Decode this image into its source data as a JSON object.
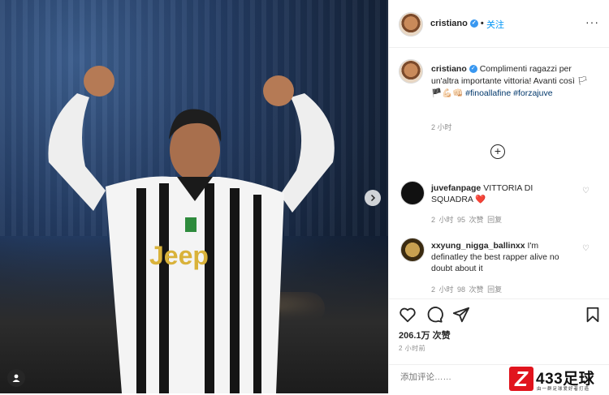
{
  "post": {
    "username": "cristiano",
    "verified_mark": "✓",
    "dot": "•",
    "follow_label": "关注",
    "more_label": "···"
  },
  "caption": {
    "username": "cristiano",
    "text": "Complimenti ragazzi per un'altra importante vittoria! Avanti così 🏳🏴💪🏻👊🏻",
    "hashtag1": "#finoallafine",
    "hashtag2": "#forzajuve",
    "time": "2 小时"
  },
  "photo": {
    "sponsor": "Jeep"
  },
  "comments": [
    {
      "username": "juvefanpage",
      "text": "VITTORIA DI SQUADRA ❤️",
      "time": "2 小时",
      "likes": "95 次赞",
      "reply": "回复"
    },
    {
      "username": "xxyung_nigga_ballinxx",
      "text": "I'm definatley the best rapper alive no doubt about it",
      "time": "2 小时",
      "likes": "98 次赞",
      "reply": "回复"
    }
  ],
  "actions": {
    "likes_count": "206.1万 次赞",
    "posted_time": "2 小时前",
    "comment_placeholder": "添加评论……"
  },
  "watermark": {
    "logo_letter": "Z",
    "title": "433足球",
    "subtitle": "由一群足球爱好者打造"
  },
  "colors": {
    "accent": "#0095f6",
    "brand_red": "#e1141d",
    "verified": "#3897f0"
  }
}
